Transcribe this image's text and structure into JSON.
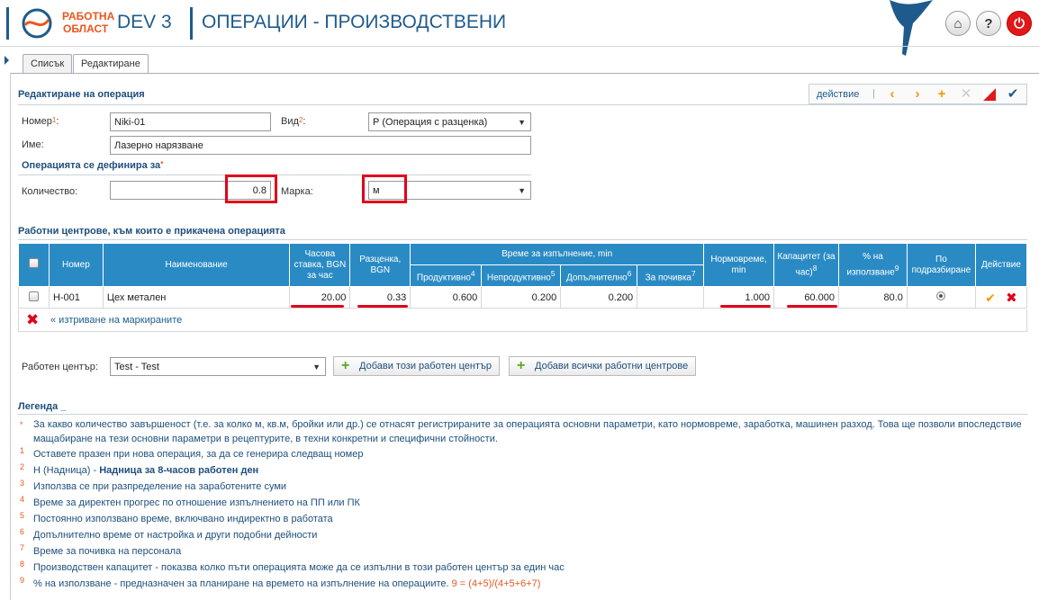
{
  "header": {
    "logo_line1": "РАБОТНА",
    "logo_line2": "ОБЛАСТ",
    "env": "DEV 3",
    "title": "ОПЕРАЦИИ - ПРОИЗВОДСТВЕНИ",
    "home_icon": "home-icon",
    "help_icon": "help-icon",
    "power_icon": "power-icon",
    "accent": "#1e5b8c",
    "brand_orange": "#e8571f"
  },
  "tabs": [
    {
      "label": "Списък"
    },
    {
      "label": "Редактиране"
    }
  ],
  "edit": {
    "title": "Редактиране на операция",
    "action_label": "действие",
    "pipe": "|"
  },
  "form": {
    "number_label": "Номер",
    "number_sup": "1",
    "number_value": "Niki-01",
    "type_label": "Вид",
    "type_sup": "2",
    "type_value": "Р (Операция с разценка)",
    "name_label": "Име:",
    "name_value": "Лазерно нарязване",
    "defined_for": "Операцията се дефинира за",
    "defined_for_sup": "*",
    "qty_label": "Количество:",
    "qty_value": "0.8",
    "unit_label": "Марка:",
    "unit_value": "м"
  },
  "centers": {
    "title": "Работни центрове, към които е прикачена операцията",
    "headers": {
      "number": "Номер",
      "name": "Наименование",
      "rate": "Часова ставка, BGN за час",
      "piece": "Разценка, BGN",
      "time_group": "Време за изпълнение, min",
      "productive": "Продуктивно",
      "productive_sup": "4",
      "unproductive": "Непродуктивно",
      "unproductive_sup": "5",
      "additional": "Допълнително",
      "additional_sup": "6",
      "rest": "За почивка",
      "rest_sup": "7",
      "norm": "Нормовреме, min",
      "capacity": "Капацитет (за час)",
      "capacity_sup": "8",
      "usage": "% на използване",
      "usage_sup": "9",
      "default": "По подразбиране",
      "action": "Действие"
    },
    "rows": [
      {
        "number": "Н-001",
        "name": "Цех метален",
        "rate": "20.00",
        "piece": "0.33",
        "productive": "0.600",
        "unproductive": "0.200",
        "additional": "0.200",
        "rest": "",
        "norm": "1.000",
        "capacity": "60.000",
        "usage": "80.0"
      }
    ],
    "delete_marked": "« изтриване на маркираните"
  },
  "workcenter": {
    "label": "Работен център:",
    "value": "Test - Test",
    "add_this": "Добави този работен център",
    "add_all": "Добави всички работни центрове"
  },
  "legend": {
    "title": "Легенда _",
    "items": [
      {
        "mark": "*",
        "text": "За какво количество завършеност (т.е. за колко м, кв.м, бройки или др.) се отнасят регистрираните за операцията основни параметри, като нормовреме, заработка, машинен разход. Това ще позволи впоследствие мащабиране на тези основни параметри в рецептурите, в техни конкретни и специфични стойности."
      },
      {
        "mark": "1",
        "text": "Оставете празен при нова операция, за да се генерира следващ номер"
      },
      {
        "mark": "2",
        "text_a": "Н (Надница) - ",
        "text_b": "Надница за 8-часов работен ден"
      },
      {
        "mark": "3",
        "text": "Използва се при разпределение на заработените суми"
      },
      {
        "mark": "4",
        "text": "Време за директен прогрес по отношение изпълнението на ПП или ПК"
      },
      {
        "mark": "5",
        "text": "Постоянно използвано време, включвано индиректно в работата"
      },
      {
        "mark": "6",
        "text": "Допълнително време от настройка и други подобни дейности"
      },
      {
        "mark": "7",
        "text": "Време за почивка на персонала"
      },
      {
        "mark": "8",
        "text": "Производствен капацитет - показва колко пъти операцията може да се изпълни в този работен център за един час"
      },
      {
        "mark": "9",
        "text_a": "% на използване - предназначен за планиране на времето на изпълнение на операциите. ",
        "text_b": "9 = (4+5)/(4+5+6+7)"
      }
    ]
  }
}
